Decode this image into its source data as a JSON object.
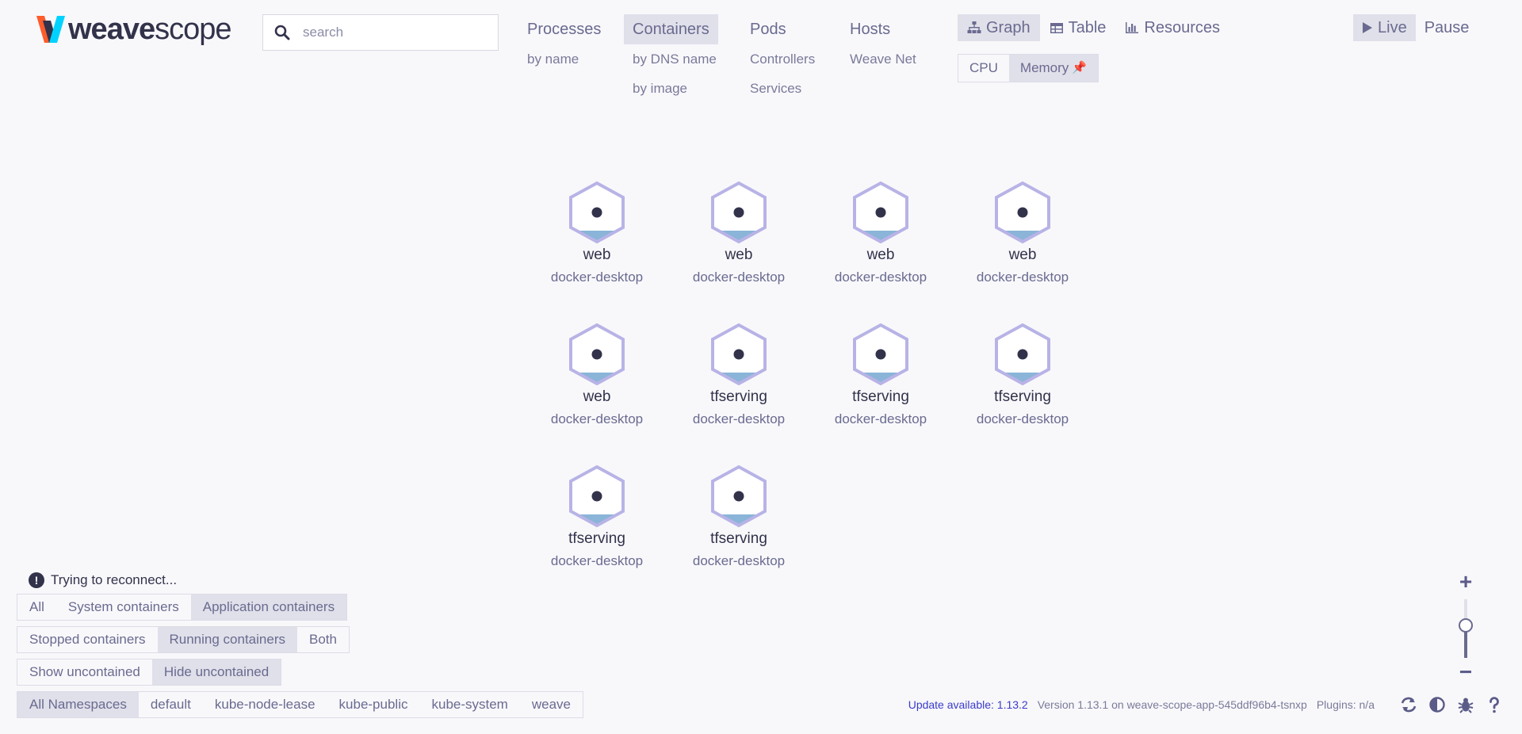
{
  "logo": {
    "brand_bold": "weave",
    "brand_light": "scope"
  },
  "search": {
    "placeholder": "search"
  },
  "topologies": [
    {
      "label": "Processes",
      "active": false,
      "subs": [
        "by name"
      ]
    },
    {
      "label": "Containers",
      "active": true,
      "subs": [
        "by DNS name",
        "by image"
      ]
    },
    {
      "label": "Pods",
      "active": false,
      "subs": [
        "Controllers",
        "Services"
      ]
    },
    {
      "label": "Hosts",
      "active": false,
      "subs": [
        "Weave Net"
      ]
    }
  ],
  "view_modes": [
    {
      "label": "Graph",
      "icon": "sitemap-icon",
      "active": true
    },
    {
      "label": "Table",
      "icon": "table-icon",
      "active": false
    },
    {
      "label": "Resources",
      "icon": "bar-chart-icon",
      "active": false
    }
  ],
  "metrics": [
    {
      "label": "CPU",
      "active": false
    },
    {
      "label": "Memory",
      "active": true,
      "pinned": true,
      "pin_glyph": "📌"
    }
  ],
  "live_controls": [
    {
      "label": "Live",
      "icon": "play-icon",
      "active": true
    },
    {
      "label": "Pause",
      "active": false
    }
  ],
  "nodes": [
    {
      "label": "web",
      "sublabel": "docker-desktop"
    },
    {
      "label": "web",
      "sublabel": "docker-desktop"
    },
    {
      "label": "web",
      "sublabel": "docker-desktop"
    },
    {
      "label": "web",
      "sublabel": "docker-desktop"
    },
    {
      "label": "web",
      "sublabel": "docker-desktop"
    },
    {
      "label": "tfserving",
      "sublabel": "docker-desktop"
    },
    {
      "label": "tfserving",
      "sublabel": "docker-desktop"
    },
    {
      "label": "tfserving",
      "sublabel": "docker-desktop"
    },
    {
      "label": "tfserving",
      "sublabel": "docker-desktop"
    },
    {
      "label": "tfserving",
      "sublabel": "docker-desktop"
    }
  ],
  "status": {
    "icon_glyph": "!",
    "text": "Trying to reconnect..."
  },
  "filters": {
    "container_type": [
      {
        "label": "All",
        "active": false
      },
      {
        "label": "System containers",
        "active": false
      },
      {
        "label": "Application containers",
        "active": true
      }
    ],
    "container_state": [
      {
        "label": "Stopped containers",
        "active": false
      },
      {
        "label": "Running containers",
        "active": true
      },
      {
        "label": "Both",
        "active": false
      }
    ],
    "uncontained": [
      {
        "label": "Show uncontained",
        "active": false
      },
      {
        "label": "Hide uncontained",
        "active": true
      }
    ],
    "namespaces": [
      {
        "label": "All Namespaces",
        "active": true
      },
      {
        "label": "default",
        "active": false
      },
      {
        "label": "kube-node-lease",
        "active": false
      },
      {
        "label": "kube-public",
        "active": false
      },
      {
        "label": "kube-system",
        "active": false
      },
      {
        "label": "weave",
        "active": false
      }
    ]
  },
  "footer": {
    "update": "Update available: 1.13.2",
    "version": "Version 1.13.1 on weave-scope-app-545ddf96b4-tsnxp",
    "plugins": "Plugins: n/a",
    "icons": [
      "refresh-icon",
      "contrast-icon",
      "bug-icon",
      "help-icon"
    ]
  },
  "zoom": {
    "plus": "+",
    "minus": "−",
    "level": 0.55
  },
  "colors": {
    "accent": "#ff5c2b",
    "node_stroke": "#b8b3e6",
    "node_dot": "#32324b",
    "memory_fill": "#8ab4d8",
    "link": "#3b3bcb"
  }
}
